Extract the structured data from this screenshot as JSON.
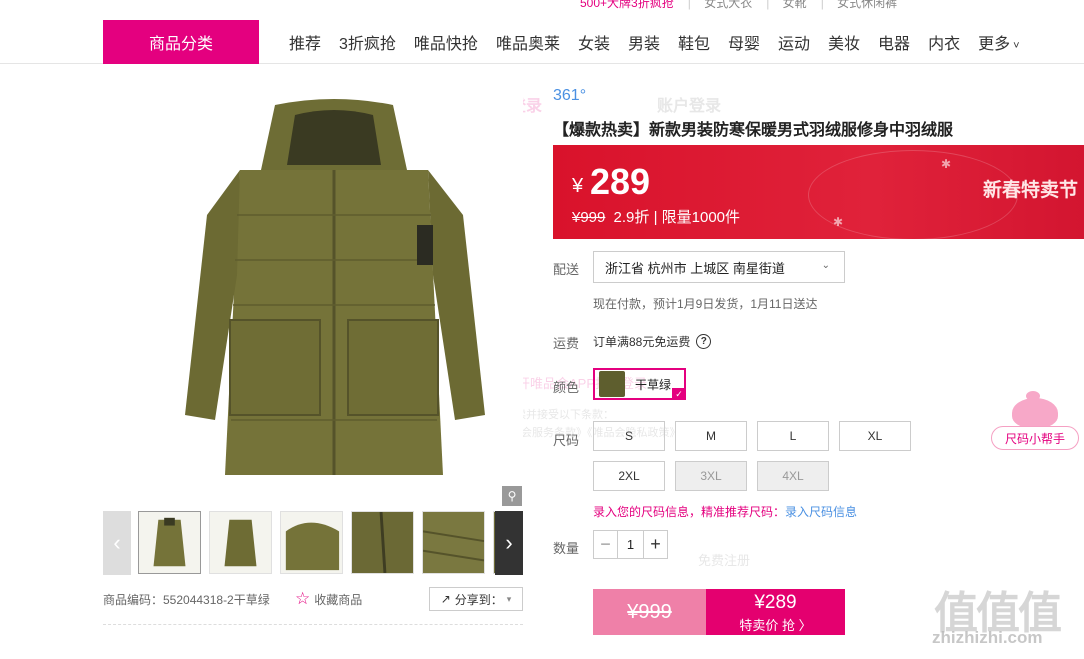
{
  "top_links": [
    "500+大牌3折疯抢",
    "女式大衣",
    "女靴",
    "女式休闲裤"
  ],
  "nav": {
    "category_button": "商品分类",
    "items": [
      "推荐",
      "3折疯抢",
      "唯品快抢",
      "唯品奥莱",
      "女装",
      "男装",
      "鞋包",
      "母婴",
      "运动",
      "美妆",
      "电器",
      "内衣",
      "更多"
    ]
  },
  "gallery": {
    "main_image": "olive-green-hooded-long-down-jacket",
    "thumb_count": 6
  },
  "meta": {
    "product_code": "商品编码：552044318-2干草绿",
    "favorite_label": "收藏商品",
    "share_label": "分享到："
  },
  "product": {
    "brand": "361°",
    "title": "【爆款热卖】新款男装防寒保暖男式羽绒服修身中羽绒服"
  },
  "price": {
    "currency": "¥",
    "current": "289",
    "original": "¥999",
    "discount": "2.9折",
    "limit": "| 限量1000件",
    "promo": "新春特卖节"
  },
  "delivery": {
    "label": "配送",
    "address": "浙江省 杭州市 上城区 南星街道",
    "note": "现在付款，预计1月9日发货，1月11日送达"
  },
  "freight": {
    "label": "运费",
    "text": "订单满88元免运费",
    "help": "?"
  },
  "color": {
    "label": "颜色",
    "selected": "干草绿",
    "swatch": "#5e5e2e"
  },
  "sizes": {
    "label": "尺码",
    "options": [
      {
        "name": "S",
        "available": true
      },
      {
        "name": "M",
        "available": true
      },
      {
        "name": "L",
        "available": true
      },
      {
        "name": "XL",
        "available": true
      },
      {
        "name": "2XL",
        "available": true
      },
      {
        "name": "3XL",
        "available": false
      },
      {
        "name": "4XL",
        "available": false
      }
    ],
    "help_text": "录入您的尺码信息，精准推荐尺码：",
    "help_link": "录入尺码信息",
    "assistant": "尺码小帮手"
  },
  "quantity": {
    "label": "数量",
    "value": "1",
    "minus": "−",
    "plus": "+"
  },
  "buy": {
    "original": "¥999",
    "price": "¥289",
    "cta": "特卖价 抢 〉"
  },
  "overlay_ghost": {
    "scan_login": "扫码登录",
    "account_login": "账户登录",
    "open_app": "打开唯品会APP扫码登录",
    "agree": "我已阅读并接受以下条款：",
    "agree2": "《唯品会服务条款》《唯品会隐私政策》",
    "register": "免费注册"
  },
  "watermark": {
    "logo": "值值值",
    "url": "zhizhizhi.com"
  },
  "colors": {
    "brand": "#e4007f",
    "price_banner": "#d9122b",
    "link": "#4a90e2"
  }
}
